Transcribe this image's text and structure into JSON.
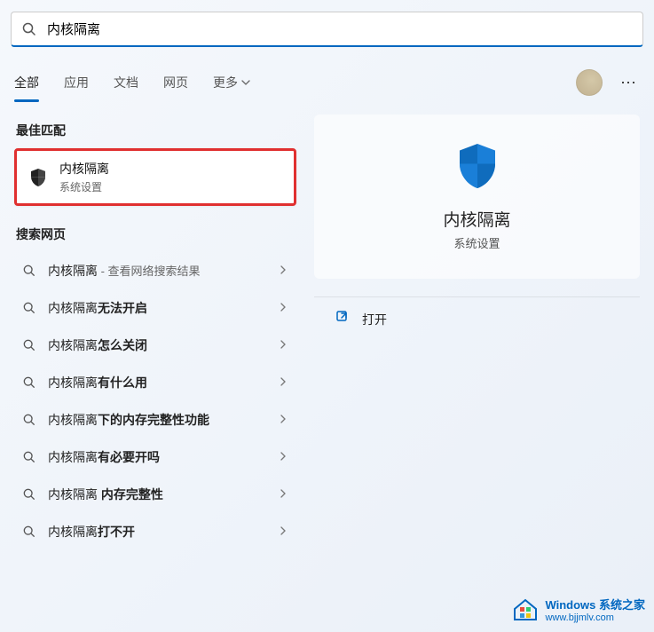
{
  "search": {
    "value": "内核隔离"
  },
  "tabs": {
    "all": "全部",
    "apps": "应用",
    "docs": "文档",
    "web": "网页",
    "more": "更多"
  },
  "sections": {
    "best_match": "最佳匹配",
    "search_web": "搜索网页"
  },
  "best_match": {
    "title": "内核隔离",
    "subtitle": "系统设置"
  },
  "web_results": [
    {
      "prefix": "内核隔离",
      "bold": "",
      "suffix": " - 查看网络搜索结果"
    },
    {
      "prefix": "内核隔离",
      "bold": "无法开启",
      "suffix": ""
    },
    {
      "prefix": "内核隔离",
      "bold": "怎么关闭",
      "suffix": ""
    },
    {
      "prefix": "内核隔离",
      "bold": "有什么用",
      "suffix": ""
    },
    {
      "prefix": "内核隔离",
      "bold": "下的内存完整性功能",
      "suffix": ""
    },
    {
      "prefix": "内核隔离",
      "bold": "有必要开吗",
      "suffix": ""
    },
    {
      "prefix": "内核隔离 ",
      "bold": "内存完整性",
      "suffix": ""
    },
    {
      "prefix": "内核隔离",
      "bold": "打不开",
      "suffix": ""
    }
  ],
  "detail": {
    "title": "内核隔离",
    "subtitle": "系统设置",
    "open": "打开"
  },
  "watermark": {
    "line1": "Windows 系统之家",
    "line2": "www.bjjmlv.com"
  }
}
